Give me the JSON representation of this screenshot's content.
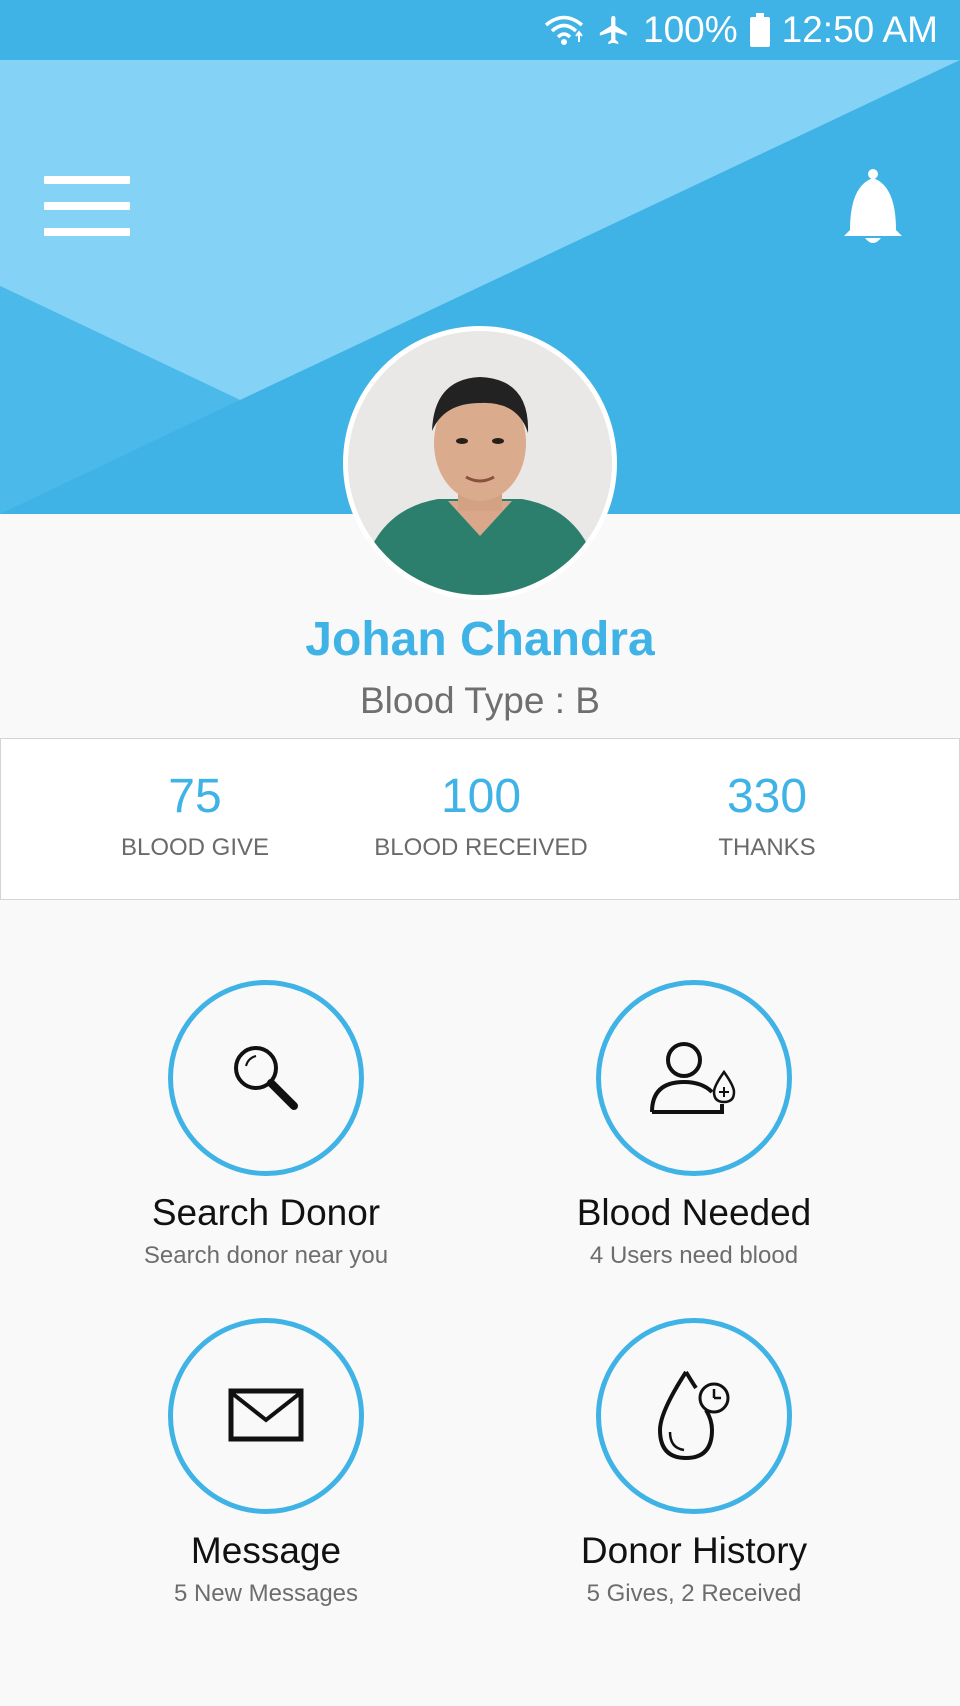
{
  "status": {
    "battery": "100%",
    "time": "12:50 AM"
  },
  "profile": {
    "name": "Johan Chandra",
    "blood_type": "Blood Type : B"
  },
  "stats": [
    {
      "value": "75",
      "label": "BLOOD GIVE"
    },
    {
      "value": "100",
      "label": "BLOOD RECEIVED"
    },
    {
      "value": "330",
      "label": "THANKS"
    }
  ],
  "menu": [
    {
      "title": "Search Donor",
      "subtitle": "Search donor near you",
      "icon": "search-icon"
    },
    {
      "title": "Blood Needed",
      "subtitle": "4 Users need blood",
      "icon": "user-blood-drop-icon"
    },
    {
      "title": "Message",
      "subtitle": "5 New Messages",
      "icon": "envelope-icon"
    },
    {
      "title": "Donor History",
      "subtitle": "5 Gives, 2 Received",
      "icon": "blood-drop-clock-icon"
    }
  ],
  "colors": {
    "primary": "#3fb2e6",
    "header_light": "#84d2f6",
    "background": "#f9f9f9"
  }
}
